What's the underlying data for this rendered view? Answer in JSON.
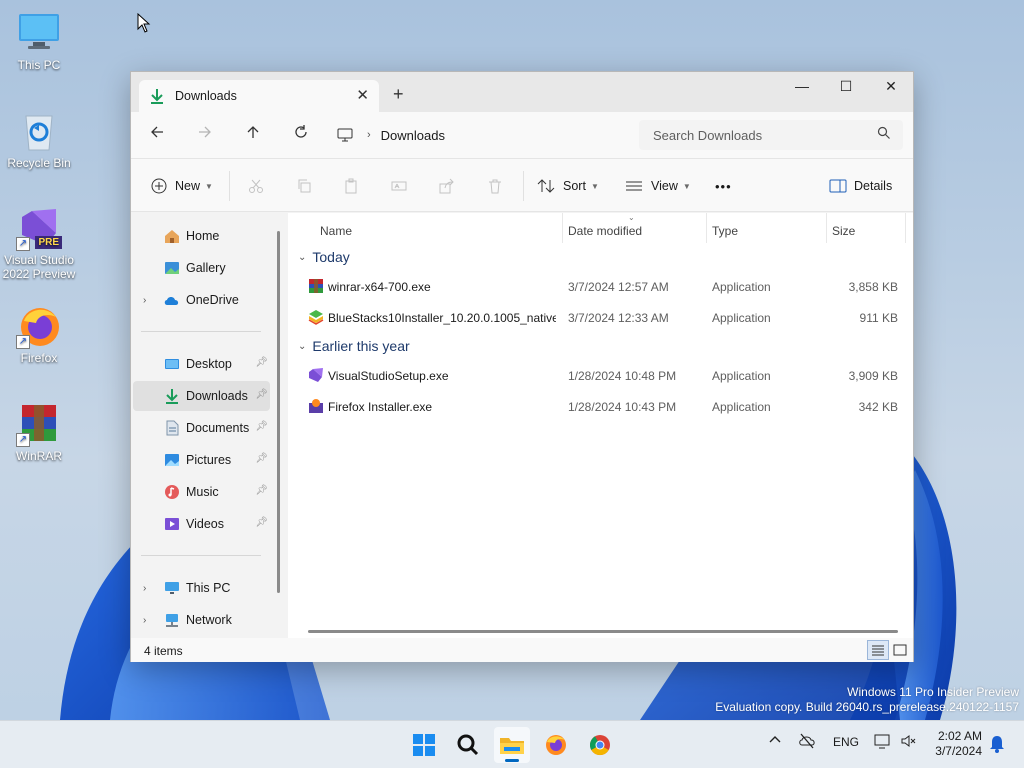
{
  "desktop": {
    "icons": [
      {
        "label": "This PC",
        "icon": "monitor-icon"
      },
      {
        "label": "Recycle Bin",
        "icon": "recycle-bin-icon"
      },
      {
        "label": "Visual Studio 2022 Preview",
        "icon": "visual-studio-icon",
        "badge": "PRE"
      },
      {
        "label": "Firefox",
        "icon": "firefox-icon"
      },
      {
        "label": "WinRAR",
        "icon": "winrar-icon"
      }
    ]
  },
  "window": {
    "tab_title": "Downloads",
    "tab_close": "✕",
    "new_tab": "+",
    "minimize": "—",
    "maximize": "☐",
    "close": "✕",
    "breadcrumb": "Downloads",
    "search_placeholder": "Search Downloads",
    "toolbar": {
      "new_label": "New",
      "sort_label": "Sort",
      "view_label": "View",
      "more_label": "•••",
      "details_label": "Details"
    },
    "nav": {
      "home": "Home",
      "gallery": "Gallery",
      "onedrive": "OneDrive",
      "desktop": "Desktop",
      "downloads": "Downloads",
      "documents": "Documents",
      "pictures": "Pictures",
      "music": "Music",
      "videos": "Videos",
      "this_pc": "This PC",
      "network": "Network"
    },
    "columns": {
      "name": "Name",
      "date": "Date modified",
      "type": "Type",
      "size": "Size"
    },
    "groups": [
      {
        "label": "Today",
        "files": [
          {
            "name": "winrar-x64-700.exe",
            "date": "3/7/2024 12:57 AM",
            "type": "Application",
            "size": "3,858 KB",
            "icon": "winrar-icon"
          },
          {
            "name": "BlueStacks10Installer_10.20.0.1005_native...",
            "date": "3/7/2024 12:33 AM",
            "type": "Application",
            "size": "911 KB",
            "icon": "bluestacks-icon"
          }
        ]
      },
      {
        "label": "Earlier this year",
        "files": [
          {
            "name": "VisualStudioSetup.exe",
            "date": "1/28/2024 10:48 PM",
            "type": "Application",
            "size": "3,909 KB",
            "icon": "visual-studio-icon"
          },
          {
            "name": "Firefox Installer.exe",
            "date": "1/28/2024 10:43 PM",
            "type": "Application",
            "size": "342 KB",
            "icon": "firefox-icon"
          }
        ]
      }
    ],
    "status_count": "4 items"
  },
  "watermark": {
    "line1": "Windows 11 Pro Insider Preview",
    "line2": "Evaluation copy. Build 26040.rs_prerelease.240122-1157"
  },
  "taskbar": {
    "apps": [
      "start-icon",
      "search-icon",
      "file-explorer-icon",
      "firefox-icon",
      "chrome-icon"
    ],
    "tray": {
      "language": "ENG",
      "time": "2:02 AM",
      "date": "3/7/2024"
    }
  },
  "colors": {
    "accent": "#0067c0",
    "window_bg": "#f3f3f3",
    "group_text": "#1e3a6b"
  }
}
